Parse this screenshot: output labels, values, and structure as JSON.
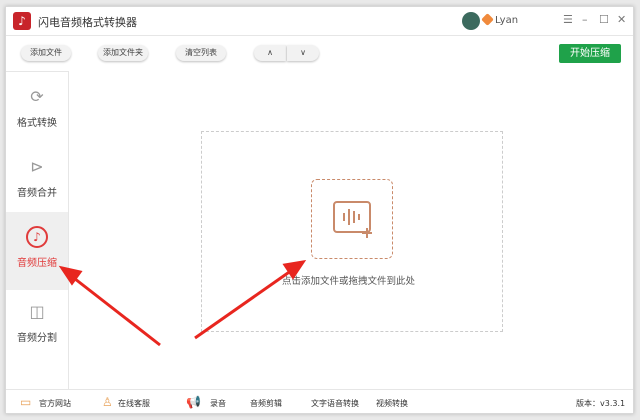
{
  "app": {
    "title": "闪电音频格式转换器",
    "user": "Lyan"
  },
  "toolbar": {
    "add_file": "添加文件",
    "add_folder": "添加文件夹",
    "clear_list": "清空列表",
    "up": "∧",
    "down": "∨",
    "start": "开始压缩"
  },
  "sidebar": {
    "items": [
      {
        "label": "格式转换"
      },
      {
        "label": "音频合并"
      },
      {
        "label": "音频压缩"
      },
      {
        "label": "音频分割"
      }
    ]
  },
  "main": {
    "hint": "点击添加文件或拖拽文件到此处"
  },
  "footer": {
    "website": "官方网站",
    "support": "在线客服",
    "record": "录音",
    "cut": "音频剪辑",
    "tts": "文字语音转换",
    "video": "视频转换",
    "version": "版本：v3.3.1"
  },
  "colors": {
    "accent": "#e03b3b",
    "start": "#1fa24a"
  }
}
